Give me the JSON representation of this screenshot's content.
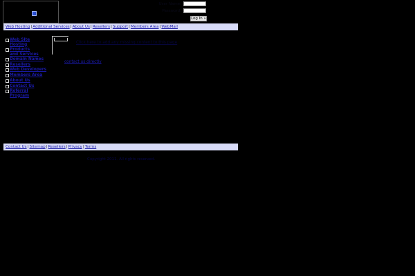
{
  "login": {
    "username_label": "User Name:",
    "password_label": "Password:",
    "username_value": "",
    "password_value": "",
    "login_button": "Log In »"
  },
  "nav": {
    "items": [
      "Web Hosting",
      "Additional Services",
      "About Us",
      "Resellers",
      "Support",
      "Members Area",
      "WebMail"
    ],
    "separator": "|"
  },
  "sidebar": {
    "items": [
      {
        "label": "Web Site Hosting"
      },
      {
        "label": "Products and Services"
      },
      {
        "label": "Domain Names"
      },
      {
        "label": "Resellers"
      },
      {
        "label": "Web Developers"
      },
      {
        "label": "Members Area"
      },
      {
        "label": "About Us"
      },
      {
        "label": "Contact Us"
      },
      {
        "label": "Referral Program"
      }
    ]
  },
  "content": {
    "faint_link": "Click here to add any missing content to this page",
    "contact_link": "contact us directly"
  },
  "footer": {
    "items": [
      "Contact Us",
      "Sitemap",
      "Resellers",
      "Privacy",
      "Terms"
    ],
    "copyright": "Copyright 2011. All rights reserved."
  },
  "colors": {
    "background": "#000000",
    "bar": "#d8dbf8",
    "link": "#1a1aa8"
  }
}
